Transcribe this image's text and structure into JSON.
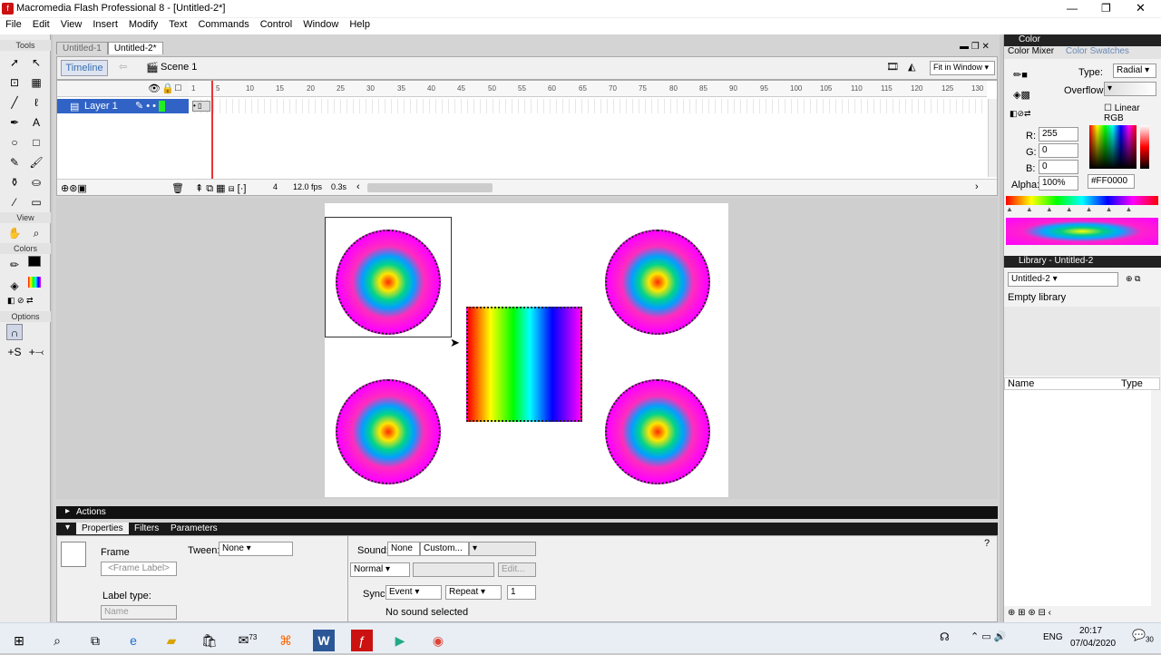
{
  "window": {
    "title": "Macromedia Flash Professional 8 - [Untitled-2*]",
    "icon": "flash-icon"
  },
  "menu": [
    "File",
    "Edit",
    "View",
    "Insert",
    "Modify",
    "Text",
    "Commands",
    "Control",
    "Window",
    "Help"
  ],
  "tools": {
    "label": "Tools",
    "view_label": "View",
    "colors_label": "Colors",
    "options_label": "Options"
  },
  "doc_tabs": [
    "Untitled-1",
    "Untitled-2*"
  ],
  "editbar": {
    "timeline_button": "Timeline",
    "scene": "Scene 1",
    "zoom": "Fit in Window"
  },
  "timeline": {
    "layer_name": "Layer 1",
    "frame_ticks": [
      "1",
      "5",
      "10",
      "15",
      "20",
      "25",
      "30",
      "35",
      "40",
      "45",
      "50",
      "55",
      "60",
      "65",
      "70",
      "75",
      "80",
      "85",
      "90",
      "95",
      "100",
      "105",
      "110",
      "115",
      "120",
      "125",
      "130"
    ],
    "current_frame": "4",
    "fps": "12.0 fps",
    "time": "0.3s"
  },
  "panels": {
    "actions": "Actions",
    "tabs": [
      "Properties",
      "Filters",
      "Parameters"
    ]
  },
  "properties": {
    "frame_label": "Frame",
    "frame_label_placeholder": "<Frame Label>",
    "tween_label": "Tween:",
    "tween_value": "None",
    "sound_label": "Sound:",
    "sound_value": "None",
    "custom_button": "Custom...",
    "edit_button": "Edit...",
    "effect_value": "Normal",
    "label_type": "Label type:",
    "label_type_value": "Name",
    "sync_label": "Sync:",
    "sync_value": "Event",
    "repeat_value": "Repeat",
    "repeat_count": "1",
    "status": "No sound selected"
  },
  "color_panel": {
    "title": "Color",
    "tab_mixer": "Color Mixer",
    "tab_swatches": "Color Swatches",
    "type_label": "Type:",
    "type_value": "Radial",
    "overflow_label": "Overflow:",
    "linear_rgb": "Linear RGB",
    "r_label": "R:",
    "r": "255",
    "g_label": "G:",
    "g": "0",
    "b_label": "B:",
    "b": "0",
    "alpha_label": "Alpha:",
    "alpha": "100%",
    "hex": "#FF0000"
  },
  "library": {
    "title": "Library - Untitled-2",
    "doc": "Untitled-2",
    "empty": "Empty library",
    "col_name": "Name",
    "col_type": "Type"
  },
  "taskbar": {
    "time": "20:17",
    "date": "07/04/2020",
    "lang": "ENG",
    "mail_badge": "73",
    "notifications": "30"
  }
}
